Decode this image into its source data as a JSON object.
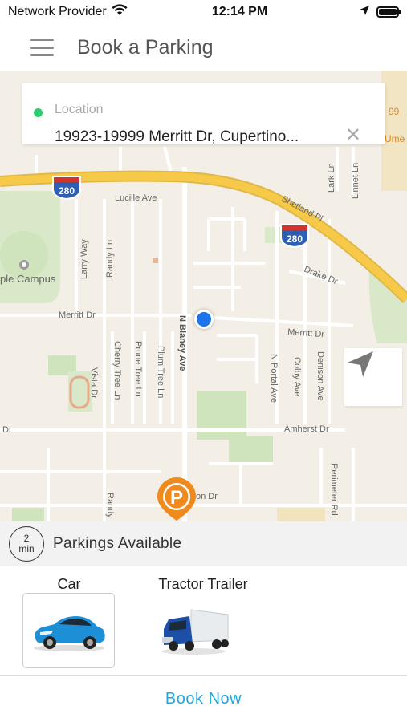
{
  "status_bar": {
    "carrier": "Network Provider",
    "time": "12:14 PM"
  },
  "header": {
    "title": "Book a Parking",
    "menu_icon": "hamburger-menu-icon"
  },
  "location": {
    "label": "Location",
    "value": "19923-19999 Merritt Dr, Cupertino...",
    "clear_icon": "close-icon",
    "dot_color": "#2ecc71"
  },
  "map": {
    "street_labels": {
      "lucille": "Lucille Ave",
      "shetland": "Shetland Pl",
      "lark": "Lark Ln",
      "linnet": "Linnet Ln",
      "apple_campus": "ple Campus",
      "larry": "Larry Way",
      "randy": "Randy Ln",
      "drake": "Drake Dr",
      "merritt_left": "Merritt Dr",
      "merritt_right": "Merritt Dr",
      "blaney": "N Blaney Ave",
      "cherry": "Cherry Tree Ln",
      "prune": "Prune Tree Ln",
      "plum": "Plum Tree Ln",
      "vista": "Vista Dr",
      "portal": "N Portal Ave",
      "colby": "Colby Ave",
      "denison": "Denison Ave",
      "amherst": "Amherst Dr",
      "perimeter": "Perimeter Rd",
      "dr_left": "Dr",
      "randy_bottom": "Randy",
      "on_dr": "on Dr",
      "edge_99": "99",
      "edge_ume": "Ume"
    },
    "highway_shield": "280",
    "parking_pin_letter": "P",
    "recenter_icon": "navigation-arrow-icon",
    "colors": {
      "highway": "#f7c948",
      "parking_pin": "#f08a1c",
      "user_location": "#1a73e8"
    }
  },
  "availability": {
    "eta_value": "2",
    "eta_unit": "min",
    "text": "Parkings Available"
  },
  "vehicles": [
    {
      "label": "Car",
      "icon": "car-icon",
      "selected": true
    },
    {
      "label": "Tractor Trailer",
      "icon": "truck-icon",
      "selected": false
    }
  ],
  "book_button": {
    "label": "Book Now",
    "color": "#22a7d9"
  }
}
